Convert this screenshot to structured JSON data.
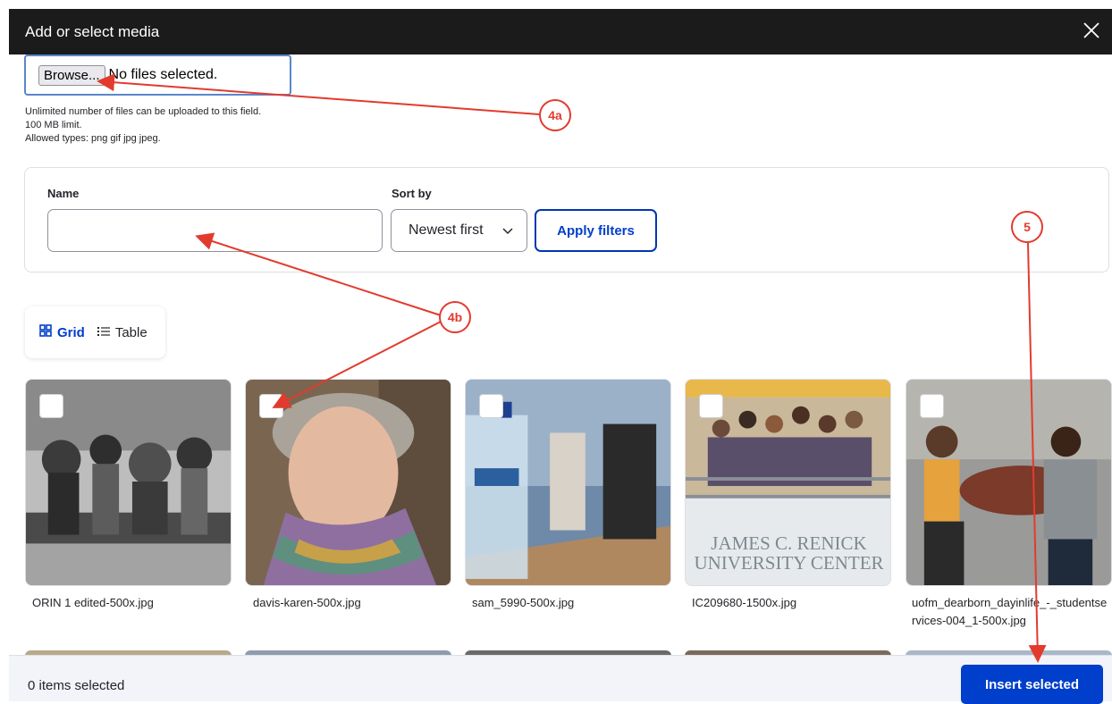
{
  "dialog": {
    "title": "Add or select media",
    "close_icon": "close-icon"
  },
  "upload": {
    "browse_label": "Browse...",
    "status": "No files selected.",
    "help": [
      "Unlimited number of files can be uploaded to this field.",
      "100 MB limit.",
      "Allowed types: png gif jpg jpeg."
    ]
  },
  "filters": {
    "name_label": "Name",
    "name_value": "",
    "sort_label": "Sort by",
    "sort_value": "Newest first",
    "apply_label": "Apply filters"
  },
  "view_toggle": {
    "grid_label": "Grid",
    "table_label": "Table",
    "active": "Grid"
  },
  "media": [
    {
      "filename": "ORIN 1 edited-500x.jpg",
      "thumb": "black-and-white photo of a group in a forest"
    },
    {
      "filename": "davis-karen-500x.jpg",
      "thumb": "portrait of smiling older woman with colorful scarf"
    },
    {
      "filename": "sam_5990-500x.jpg",
      "thumb": "water bottle on table with people in background"
    },
    {
      "filename": "IC209680-1500x.jpg",
      "thumb": "group of people on balcony above JAMES C. RENICK UNIVERSITY CENTER sign"
    },
    {
      "filename": "uofm_dearborn_dayinlife_-_studentservices-004_1-500x.jpg",
      "thumb": "two women talking at a round table"
    }
  ],
  "thumb_sign": {
    "line1": "JAMES C. RENICK",
    "line2": "UNIVERSITY CENTER"
  },
  "footer": {
    "count_text": "0 items selected",
    "insert_label": "Insert selected"
  },
  "annotations": [
    "4a",
    "4b",
    "5"
  ],
  "colors": {
    "primary": "#003ecc",
    "annotation": "#e23b2e",
    "titlebar": "#1b1b1b"
  }
}
